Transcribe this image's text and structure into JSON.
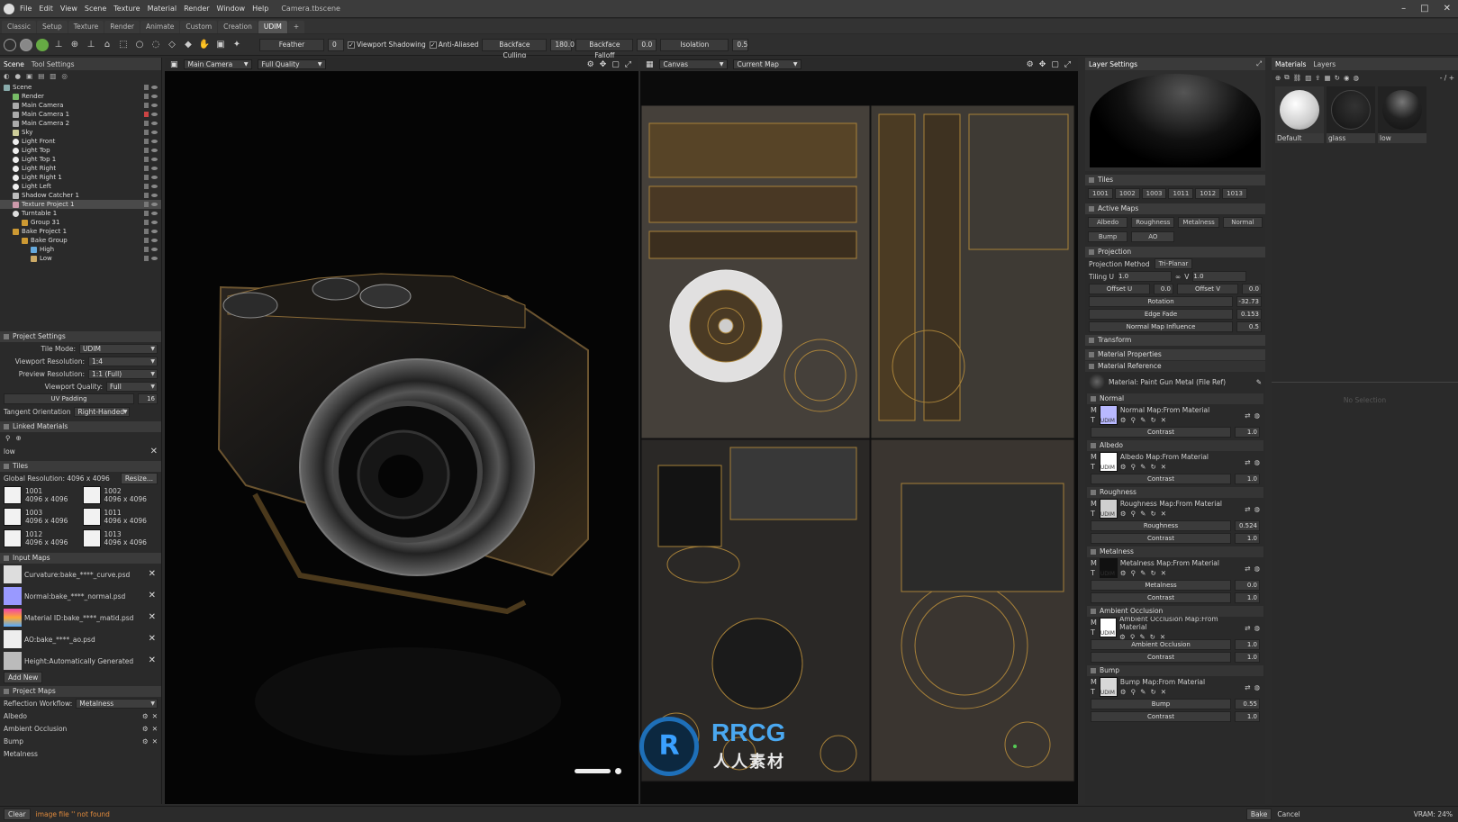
{
  "app": {
    "title": "Camera.tbscene",
    "menu": [
      "File",
      "Edit",
      "View",
      "Scene",
      "Texture",
      "Material",
      "Render",
      "Window",
      "Help"
    ]
  },
  "workspace_tabs": [
    "Classic",
    "Setup",
    "Texture",
    "Render",
    "Animate",
    "Custom",
    "Creation",
    "UDIM",
    "+"
  ],
  "toolbar": {
    "feather_label": "Feather",
    "feather_value": "0",
    "viewport_shadowing": "Viewport Shadowing",
    "anti_aliased": "Anti-Aliased",
    "backface_culling": "Backface Culling",
    "backface_culling_value": "180.0",
    "backface_falloff": "Backface Falloff",
    "backface_falloff_value": "0.0",
    "isolation": "Isolation",
    "isolation_value": "0.5"
  },
  "scene_panel": {
    "tabs": [
      "Scene",
      "Tool Settings"
    ],
    "items": [
      "Scene",
      "Render",
      "Main Camera",
      "Main Camera 1",
      "Main Camera 2",
      "Sky",
      "Light Front",
      "Light Top",
      "Light Top 1",
      "Light Right",
      "Light Right 1",
      "Light Left",
      "Shadow Catcher 1",
      "Texture Project 1",
      "Turntable 1",
      "Group 31",
      "Bake Project 1",
      "Bake Group",
      "High",
      "Low"
    ]
  },
  "project_settings": {
    "title": "Project Settings",
    "tile_mode_label": "Tile Mode:",
    "tile_mode": "UDIM",
    "viewport_res_label": "Viewport Resolution:",
    "viewport_res": "1:4",
    "preview_res_label": "Preview Resolution:",
    "preview_res": "1:1 (Full)",
    "viewport_quality_label": "Viewport Quality:",
    "viewport_quality": "Full",
    "uv_padding_label": "UV Padding",
    "uv_padding": "16",
    "tangent_label": "Tangent Orientation",
    "tangent": "Right-Handed"
  },
  "linked_materials": {
    "title": "Linked Materials",
    "value": "low"
  },
  "tiles": {
    "title": "Tiles",
    "global_res": "Global Resolution: 4096 x 4096",
    "resize": "Resize...",
    "items": [
      {
        "id": "1001",
        "res": "4096 x 4096"
      },
      {
        "id": "1002",
        "res": "4096 x 4096"
      },
      {
        "id": "1003",
        "res": "4096 x 4096"
      },
      {
        "id": "1011",
        "res": "4096 x 4096"
      },
      {
        "id": "1012",
        "res": "4096 x 4096"
      },
      {
        "id": "1013",
        "res": "4096 x 4096"
      }
    ]
  },
  "input_maps": {
    "title": "Input Maps",
    "items": [
      "Curvature:bake_****_curve.psd",
      "Normal:bake_****_normal.psd",
      "Material ID:bake_****_matid.psd",
      "AO:bake_****_ao.psd",
      "Height:Automatically Generated"
    ],
    "add_new": "Add New"
  },
  "project_maps": {
    "title": "Project Maps",
    "workflow_label": "Reflection Workflow:",
    "workflow": "Metalness",
    "items": [
      "Albedo",
      "Ambient Occlusion",
      "Bump",
      "Metalness"
    ]
  },
  "viewport1": {
    "camera": "Main Camera",
    "quality": "Full Quality"
  },
  "viewport2": {
    "mode": "Canvas",
    "map": "Current Map"
  },
  "layer_settings": {
    "title": "Layer Settings",
    "tiles_title": "Tiles",
    "tiles": [
      "1001",
      "1002",
      "1003",
      "1011",
      "1012",
      "1013"
    ],
    "active_maps_title": "Active Maps",
    "active_maps": [
      "Albedo",
      "Roughness",
      "Metalness",
      "Normal",
      "Bump",
      "AO"
    ],
    "projection_title": "Projection",
    "projection_method_label": "Projection Method",
    "projection_method": "Tri-Planar",
    "tiling_u_label": "Tiling U",
    "tiling_u": "1.0",
    "tiling_v_label": "V",
    "tiling_v": "1.0",
    "offset_u_label": "Offset U",
    "offset_u": "0.0",
    "offset_v_label": "Offset V",
    "offset_v": "0.0",
    "rotation_label": "Rotation",
    "rotation": "-32.73",
    "edge_fade_label": "Edge Fade",
    "edge_fade": "0.153",
    "nmi_label": "Normal Map Influence",
    "nmi": "0.5",
    "transform_title": "Transform",
    "mat_props_title": "Material Properties",
    "mat_ref_title": "Material Reference",
    "mat_ref": "Material: Paint Gun Metal (File Ref)",
    "channels": [
      {
        "title": "Normal",
        "map": "Normal Map:From Material",
        "slider_label": "",
        "slider_value": "",
        "contrast": "1.0"
      },
      {
        "title": "Albedo",
        "map": "Albedo Map:From Material",
        "slider_label": "",
        "slider_value": "",
        "contrast": "1.0"
      },
      {
        "title": "Roughness",
        "map": "Roughness Map:From Material",
        "slider_label": "Roughness",
        "slider_value": "0.524",
        "contrast": "1.0"
      },
      {
        "title": "Metalness",
        "map": "Metalness Map:From Material",
        "slider_label": "Metalness",
        "slider_value": "0.0",
        "contrast": "1.0"
      },
      {
        "title": "Ambient Occlusion",
        "map": "Ambient Occlusion Map:From Material",
        "slider_label": "Ambient Occlusion",
        "slider_value": "1.0",
        "contrast": "1.0"
      },
      {
        "title": "Bump",
        "map": "Bump Map:From Material",
        "slider_label": "Bump",
        "slider_value": "0.55",
        "contrast": "1.0"
      }
    ],
    "contrast_label": "Contrast",
    "udim": "UDIM"
  },
  "materials_panel": {
    "tabs": [
      "Materials",
      "Layers"
    ],
    "items": [
      "Default",
      "glass",
      "low"
    ],
    "no_selection": "No Selection",
    "zoom": "- / +"
  },
  "watermark": {
    "brand": "RRCG",
    "sub": "人人素材"
  },
  "status": {
    "clear": "Clear",
    "message": "image file '' not found",
    "bake": "Bake",
    "cancel": "Cancel",
    "vram": "VRAM: 24%"
  }
}
